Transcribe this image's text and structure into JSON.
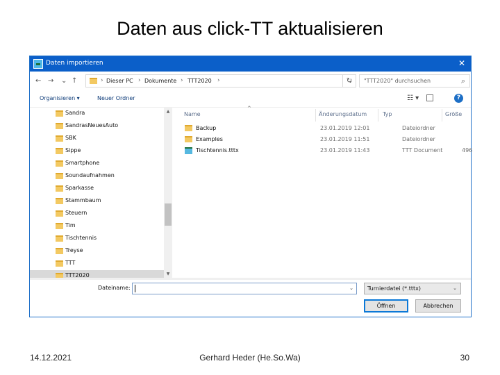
{
  "slide": {
    "title": "Daten aus click-TT aktualisieren",
    "footer_date": "14.12.2021",
    "footer_author": "Gerhard Heder (He.So.Wa)",
    "footer_page": "30"
  },
  "dialog": {
    "title": "Daten importieren",
    "close_glyph": "✕",
    "nav": {
      "back_glyph": "←",
      "forward_glyph": "→",
      "up_glyph": "↑",
      "recent_glyph": "⌄",
      "sep_glyph": "›",
      "breadcrumb": [
        "Dieser PC",
        "Dokumente",
        "TTT2020"
      ],
      "refresh_glyph": "↻",
      "search_placeholder": "\"TTT2020\" durchsuchen",
      "search_glyph": "⌕"
    },
    "toolbar": {
      "organize": "Organisieren ▾",
      "new_folder": "Neuer Ordner",
      "view_glyph": "☷ ▾",
      "help_glyph": "?"
    },
    "tree": {
      "items": [
        {
          "label": "Sandra",
          "selected": false
        },
        {
          "label": "SandrasNeuesAuto",
          "selected": false
        },
        {
          "label": "SBK",
          "selected": false
        },
        {
          "label": "Sippe",
          "selected": false
        },
        {
          "label": "Smartphone",
          "selected": false
        },
        {
          "label": "Soundaufnahmen",
          "selected": false
        },
        {
          "label": "Sparkasse",
          "selected": false
        },
        {
          "label": "Stammbaum",
          "selected": false
        },
        {
          "label": "Steuern",
          "selected": false
        },
        {
          "label": "Tim",
          "selected": false
        },
        {
          "label": "Tischtennis",
          "selected": false
        },
        {
          "label": "Treyse",
          "selected": false
        },
        {
          "label": "TTT",
          "selected": false
        },
        {
          "label": "TTT2020",
          "selected": true
        }
      ],
      "scroll_up": "▲",
      "scroll_down": "▼"
    },
    "files": {
      "sort_glyph": "^",
      "headers": {
        "name": "Name",
        "date": "Änderungsdatum",
        "type": "Typ",
        "size": "Größe"
      },
      "rows": [
        {
          "name": "Backup",
          "date": "23.01.2019 12:01",
          "type": "Dateiordner",
          "size": "",
          "icon": "folder-icon"
        },
        {
          "name": "Examples",
          "date": "23.01.2019 11:51",
          "type": "Dateiordner",
          "size": "",
          "icon": "folder-icon"
        },
        {
          "name": "Tischtennis.tttx",
          "date": "23.01.2019 11:43",
          "type": "TTT Document",
          "size": "496",
          "icon": "ttt-document-icon"
        }
      ]
    },
    "footer": {
      "filename_label": "Dateiname:",
      "filename_value": "",
      "dropdown_glyph": "⌄",
      "filetype": "Turnierdatei (*.tttx)",
      "open_label": "Öffnen",
      "cancel_label": "Abbrechen"
    }
  }
}
